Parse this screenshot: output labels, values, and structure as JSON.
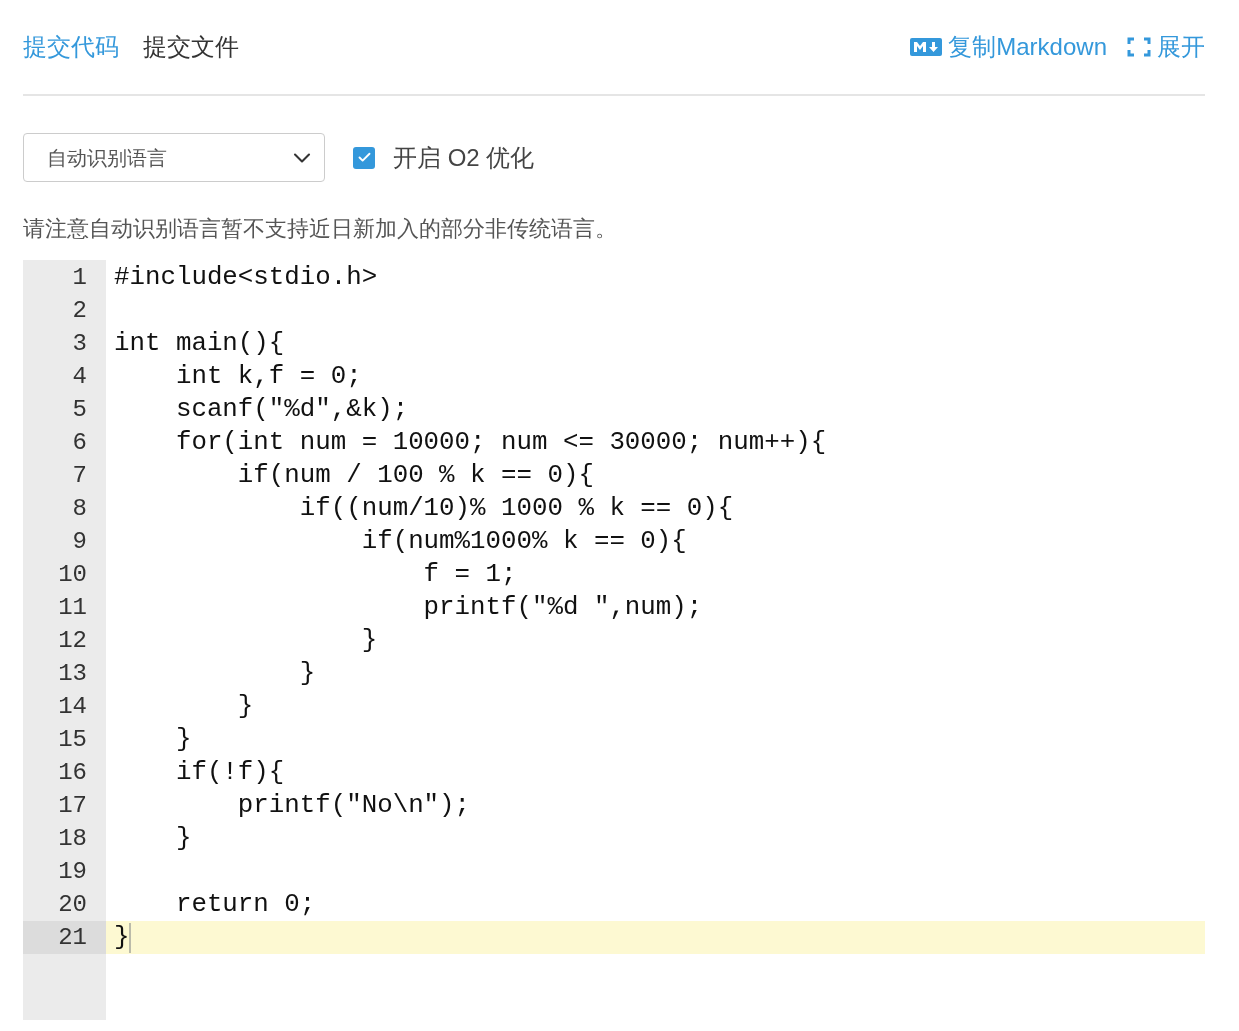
{
  "tabs": [
    {
      "label": "提交代码",
      "selected": true
    },
    {
      "label": "提交文件",
      "selected": false
    }
  ],
  "actions": [
    {
      "kind": "markdown",
      "label": "复制Markdown"
    },
    {
      "kind": "expand",
      "label": "展开"
    }
  ],
  "language_select": {
    "value": "自动识别语言"
  },
  "o2": {
    "label": "开启 O2 优化",
    "checked": true
  },
  "notice": "请注意自动识别语言暂不支持近日新加入的部分非传统语言。",
  "editor": {
    "lines": [
      {
        "number": "1",
        "text": "#include<stdio.h>",
        "active": false
      },
      {
        "number": "2",
        "active": false
      },
      {
        "number": "3",
        "text": "int main(){",
        "active": false
      },
      {
        "number": "4",
        "text": "    int k,f = 0;",
        "active": false
      },
      {
        "number": "5",
        "text": "    scanf(\"%d\",&k);",
        "active": false
      },
      {
        "number": "6",
        "text": "    for(int num = 10000; num <= 30000; num++){",
        "active": false
      },
      {
        "number": "7",
        "text": "        if(num / 100 % k == 0){",
        "active": false
      },
      {
        "number": "8",
        "text": "            if((num/10)% 1000 % k == 0){",
        "active": false
      },
      {
        "number": "9",
        "text": "                if(num%1000% k == 0){",
        "active": false
      },
      {
        "number": "10",
        "text": "                    f = 1;",
        "active": false
      },
      {
        "number": "11",
        "text": "                    printf(\"%d \",num);",
        "active": false
      },
      {
        "number": "12",
        "text": "                }",
        "active": false
      },
      {
        "number": "13",
        "text": "            }",
        "active": false
      },
      {
        "number": "14",
        "text": "        }",
        "active": false
      },
      {
        "number": "15",
        "text": "    }",
        "active": false
      },
      {
        "number": "16",
        "text": "    if(!f){",
        "active": false
      },
      {
        "number": "17",
        "text": "        printf(\"No\\n\");",
        "active": false
      },
      {
        "number": "18",
        "text": "    }",
        "active": false
      },
      {
        "number": "19",
        "active": false
      },
      {
        "number": "20",
        "text": "    return 0;",
        "active": false
      },
      {
        "number": "21",
        "text": "}",
        "active": true
      }
    ]
  }
}
